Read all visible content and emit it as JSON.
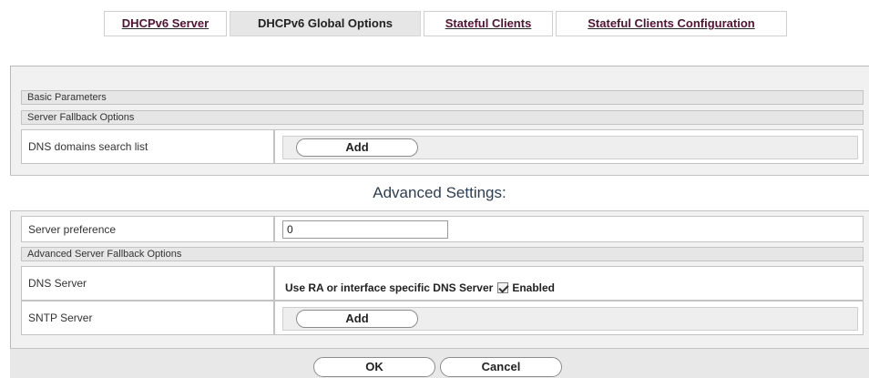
{
  "tabs": [
    {
      "label": "DHCPv6 Server",
      "active": false
    },
    {
      "label": "DHCPv6 Global Options",
      "active": true
    },
    {
      "label": "Stateful Clients",
      "active": false
    },
    {
      "label": "Stateful Clients Configuration",
      "active": false
    }
  ],
  "basic": {
    "section_title": "Basic Parameters",
    "fallback_title": "Server Fallback Options",
    "dns_search_label": "DNS domains search list",
    "dns_search_add": "Add"
  },
  "advanced": {
    "title": "Advanced Settings:",
    "server_pref_label": "Server preference",
    "server_pref_value": "0",
    "fallback_title": "Advanced Server Fallback Options",
    "dns_server_label": "DNS Server",
    "dns_server_text": "Use RA or interface specific DNS Server",
    "dns_server_checkbox_label": "Enabled",
    "dns_server_checked": true,
    "sntp_label": "SNTP Server",
    "sntp_add": "Add"
  },
  "actions": {
    "ok": "OK",
    "cancel": "Cancel"
  },
  "colors": {
    "link": "#5a0f32",
    "title": "#2c3e54",
    "section_bg": "#e6e6e6",
    "border": "#c3c3c3"
  }
}
